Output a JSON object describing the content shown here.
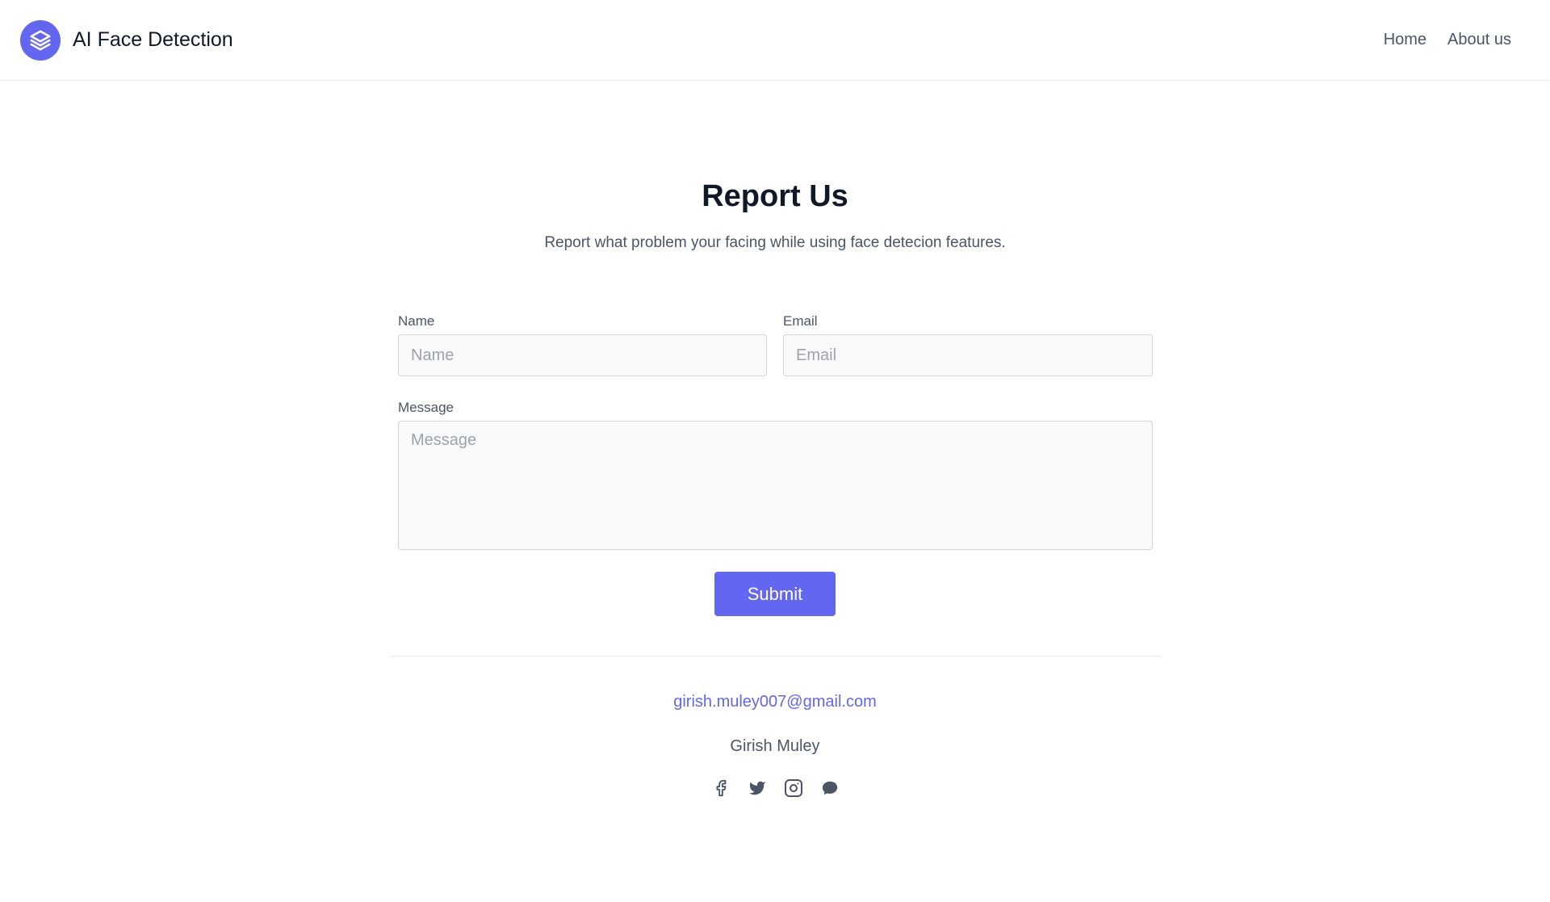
{
  "header": {
    "brand_name": "AI Face Detection",
    "logo_icon": "stack-layers-icon",
    "nav": [
      {
        "label": "Home"
      },
      {
        "label": "About us"
      }
    ]
  },
  "main": {
    "title": "Report Us",
    "subtitle": "Report what problem your facing while using face detecion features.",
    "form": {
      "name_label": "Name",
      "name_placeholder": "Name",
      "name_value": "",
      "email_label": "Email",
      "email_placeholder": "Email",
      "email_value": "",
      "message_label": "Message",
      "message_placeholder": "Message",
      "message_value": "",
      "submit_label": "Submit"
    }
  },
  "footer": {
    "email": "girish.muley007@gmail.com",
    "author": "Girish Muley",
    "socials": [
      "facebook-icon",
      "twitter-icon",
      "instagram-icon",
      "chat-icon"
    ]
  },
  "colors": {
    "accent": "#6366f1",
    "text_dark": "#111827",
    "text_muted": "#4b5563",
    "field_bg": "#f9f9f9",
    "border": "#d1d5db"
  }
}
